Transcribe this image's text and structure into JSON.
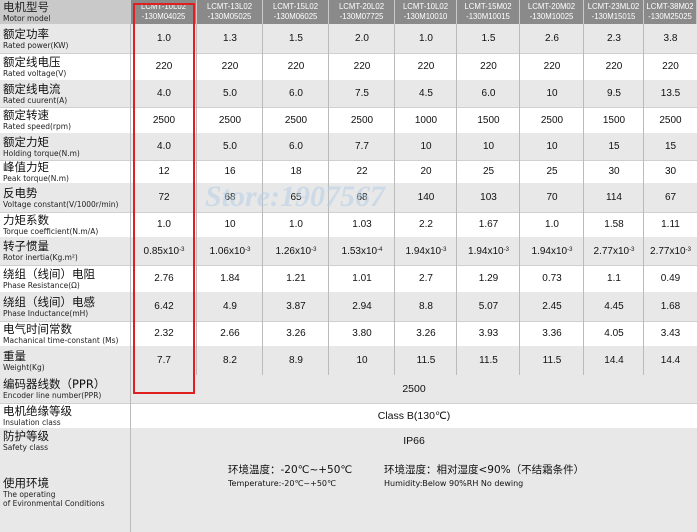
{
  "header": {
    "label_zh": "电机型号",
    "label_en": "Motor model",
    "models": [
      [
        "LCMT-10L02",
        "-130M04025"
      ],
      [
        "LCMT-13L02",
        "-130M05025"
      ],
      [
        "LCMT-15L02",
        "-130M06025"
      ],
      [
        "LCMT-20L02",
        "-130M07725"
      ],
      [
        "LCMT-10L02",
        "-130M10010"
      ],
      [
        "LCMT-15M02",
        "-130M10015"
      ],
      [
        "LCMT-20M02",
        "-130M10025"
      ],
      [
        "LCMT-23ML02",
        "-130M15015"
      ],
      [
        "LCMT-38M02",
        "-130M25025"
      ]
    ]
  },
  "rows": [
    {
      "zh": "额定功率",
      "en": "Rated power(KW)",
      "values": [
        "1.0",
        "1.3",
        "1.5",
        "2.0",
        "1.0",
        "1.5",
        "2.6",
        "2.3",
        "3.8"
      ]
    },
    {
      "zh": "额定线电压",
      "en": "Rated voltage(V)",
      "values": [
        "220",
        "220",
        "220",
        "220",
        "220",
        "220",
        "220",
        "220",
        "220"
      ]
    },
    {
      "zh": "额定线电流",
      "en": "Rated cuurent(A)",
      "values": [
        "4.0",
        "5.0",
        "6.0",
        "7.5",
        "4.5",
        "6.0",
        "10",
        "9.5",
        "13.5"
      ]
    },
    {
      "zh": "额定转速",
      "en": "Rated speed(rpm)",
      "values": [
        "2500",
        "2500",
        "2500",
        "2500",
        "1000",
        "1500",
        "2500",
        "1500",
        "2500"
      ]
    },
    {
      "zh": "额定力矩",
      "en": "Holding torque(N.m)",
      "values": [
        "4.0",
        "5.0",
        "6.0",
        "7.7",
        "10",
        "10",
        "10",
        "15",
        "15"
      ]
    },
    {
      "zh": "峰值力矩",
      "en": "Peak torque(N.m)",
      "values": [
        "12",
        "16",
        "18",
        "22",
        "20",
        "25",
        "25",
        "30",
        "30"
      ]
    },
    {
      "zh": "反电势",
      "en": "Voltage constant(V/1000r/min)",
      "values": [
        "72",
        "68",
        "65",
        "68",
        "140",
        "103",
        "70",
        "114",
        "67"
      ]
    },
    {
      "zh": "力矩系数",
      "en": "Torque coefficient(N.m/A)",
      "values": [
        "1.0",
        "10",
        "1.0",
        "1.03",
        "2.2",
        "1.67",
        "1.0",
        "1.58",
        "1.11"
      ]
    },
    {
      "zh": "转子惯量",
      "en": "Rotor inertia(Kg.m²)",
      "values": [
        {
          "b": "0.85x10",
          "e": "-3"
        },
        {
          "b": "1.06x10",
          "e": "-3"
        },
        {
          "b": "1.26x10",
          "e": "-3"
        },
        {
          "b": "1.53x10",
          "e": "-4"
        },
        {
          "b": "1.94x10",
          "e": "-3"
        },
        {
          "b": "1.94x10",
          "e": "-3"
        },
        {
          "b": "1.94x10",
          "e": "-3"
        },
        {
          "b": "2.77x10",
          "e": "-3"
        },
        {
          "b": "2.77x10",
          "e": "-3"
        }
      ]
    },
    {
      "zh": "绕组（线间）电阻",
      "en": "Phase Resistance(Ω)",
      "values": [
        "2.76",
        "1.84",
        "1.21",
        "1.01",
        "2.7",
        "1.29",
        "0.73",
        "1.1",
        "0.49"
      ]
    },
    {
      "zh": "绕组（线间）电感",
      "en": "Phase Inductance(mH)",
      "values": [
        "6.42",
        "4.9",
        "3.87",
        "2.94",
        "8.8",
        "5.07",
        "2.45",
        "4.45",
        "1.68"
      ]
    },
    {
      "zh": "电气时间常数",
      "en": "Machanical time-constant (Ms)",
      "values": [
        "2.32",
        "2.66",
        "3.26",
        "3.80",
        "3.26",
        "3.93",
        "3.36",
        "4.05",
        "3.43"
      ]
    },
    {
      "zh": "重量",
      "en": "Weight(Kg)",
      "values": [
        "7.7",
        "8.2",
        "8.9",
        "10",
        "11.5",
        "11.5",
        "11.5",
        "14.4",
        "14.4"
      ]
    }
  ],
  "spans": [
    {
      "zh": "编码器线数（PPR）",
      "en": "Encoder line number(PPR)",
      "value": "2500"
    },
    {
      "zh": "电机绝缘等级",
      "en": "Insulation class",
      "value": "Class B(130℃)"
    },
    {
      "zh": "防护等级",
      "en": "Safety class",
      "value": "IP66"
    }
  ],
  "env": {
    "zh": "使用环境",
    "en1": "The operating",
    "en2": "of Evironmental Conditions",
    "temp_zh": "环境温度：-20℃~+50℃",
    "temp_en": "Temperature:-20℃~+50℃",
    "hum_zh": "环境湿度：相对湿度<90%（不结霜条件）",
    "hum_en": "Humidity:Below 90%RH No dewing"
  },
  "watermark": "Store:1907567",
  "colors": {
    "highlight": "#e02020",
    "header_bg": "#8a8a8a",
    "alt_row": "#e8e8e8"
  }
}
